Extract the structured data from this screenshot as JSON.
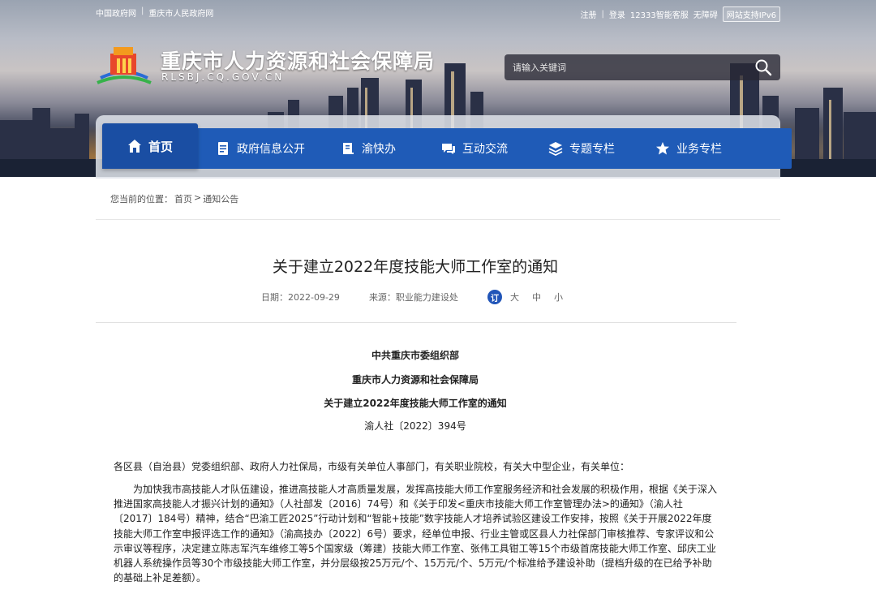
{
  "top_links": [
    "中国政府网",
    "重庆市人民政府网"
  ],
  "right_links": [
    "注册",
    "登录",
    "12333智能客服",
    "无障碍"
  ],
  "ipv6_label": "网站支持IPv6",
  "site": {
    "title": "重庆市人力资源和社会保障局",
    "domain": "RLSBJ.CQ.GOV.CN"
  },
  "search": {
    "placeholder": "请输入关键词"
  },
  "nav": [
    {
      "label": "首页",
      "icon": "home-icon"
    },
    {
      "label": "政府信息公开",
      "icon": "document-icon"
    },
    {
      "label": "渝快办",
      "icon": "book-icon"
    },
    {
      "label": "互动交流",
      "icon": "chat-icon"
    },
    {
      "label": "专题专栏",
      "icon": "layers-icon"
    },
    {
      "label": "业务专栏",
      "icon": "star-icon"
    }
  ],
  "breadcrumb": {
    "prefix": "您当前的位置：",
    "home": "首页",
    "separator": ">",
    "current": "通知公告"
  },
  "article": {
    "title": "关于建立2022年度技能大师工作室的通知",
    "date": "日期：2022-09-29",
    "source": "来源：职业能力建设处",
    "share_label": "订",
    "font_sizes": [
      "大",
      "中",
      "小"
    ],
    "issuer1": "中共重庆市委组织部",
    "issuer2": "重庆市人力资源和社会保障局",
    "doc_title": "关于建立2022年度技能大师工作室的通知",
    "doc_number": "渝人社〔2022〕394号",
    "salutation": "各区县（自治县）党委组织部、政府人力社保局，市级有关单位人事部门，有关职业院校，有关大中型企业，有关单位：",
    "paragraph": "为加快我市高技能人才队伍建设，推进高技能人才高质量发展，发挥高技能大师工作室服务经济和社会发展的积极作用，根据《关于深入推进国家高技能人才振兴计划的通知》（人社部发〔2016〕74号）和《关于印发<重庆市技能大师工作室管理办法>的通知》（渝人社〔2017〕184号）精神，结合“巴渝工匠2025”行动计划和“智能+技能”数字技能人才培养试验区建设工作安排，按照《关于开展2022年度技能大师工作室申报评选工作的通知》（渝高技办〔2022〕6号）要求，经单位申报、行业主管或区县人力社保部门审核推荐、专家评议和公示审议等程序，决定建立陈志军汽车维修工等5个国家级（筹建）技能大师工作室、张伟工具钳工等15个市级首席技能大师工作室、邱庆工业机器人系统操作员等30个市级技能大师工作室，并分层级按25万元/个、15万元/个、5万元/个标准给予建设补助（提档升级的在已给予补助的基础上补足差额）。"
  },
  "colors": {
    "nav_blue": "#1f5bb7",
    "nav_active": "#1a4ea3",
    "share_blue": "#2155b8"
  }
}
